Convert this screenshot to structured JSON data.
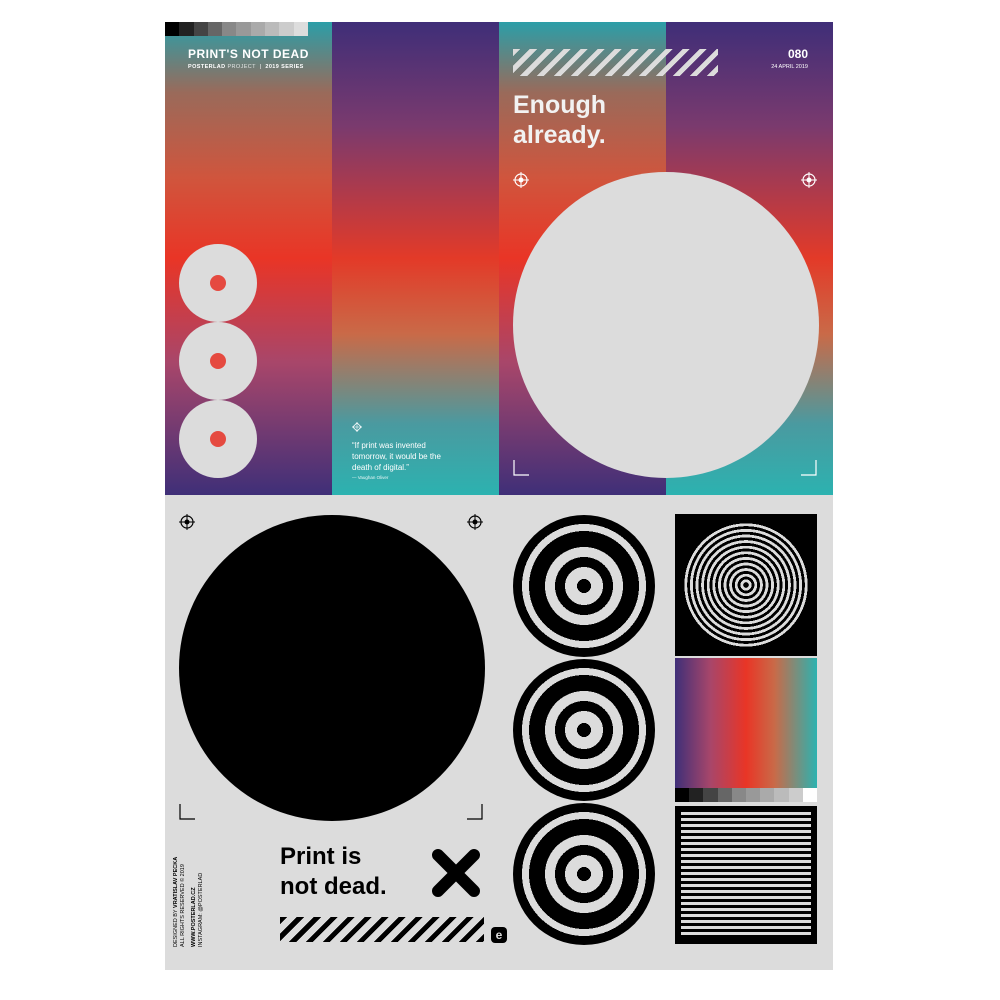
{
  "header": {
    "title": "PRINT'S NOT DEAD",
    "subtitle_brand": "POSTERLAD",
    "subtitle_project": "PROJECT",
    "subtitle_series": "2019 SERIES",
    "number": "080",
    "date": "24 APRIL 2019"
  },
  "headline": {
    "line1": "Enough",
    "line2": "already."
  },
  "quote": {
    "text": "“If print was invented tomorrow, it would be the death of digital.”",
    "author": "— Vaughan Oliver"
  },
  "bottom": {
    "line1": "Print is",
    "line2": "not dead.",
    "logo_letter": "e"
  },
  "credits": {
    "designed_by_label": "DESIGNED BY",
    "designer": "VRATISLAV PECKA",
    "rights": "ALL RIGHTS RESERVED © 2019",
    "website": "WWW.POSTERLAD.CZ",
    "instagram": "INSTAGRAM: @POSTERLAD"
  },
  "colors": {
    "background": "#dcdcdc",
    "ink": "#000000",
    "teal": "#2cb2b0",
    "red": "#e93526",
    "purple": "#3f2f78"
  },
  "icons": [
    "crosshair-icon",
    "x-mark-icon",
    "logo-e-icon"
  ]
}
